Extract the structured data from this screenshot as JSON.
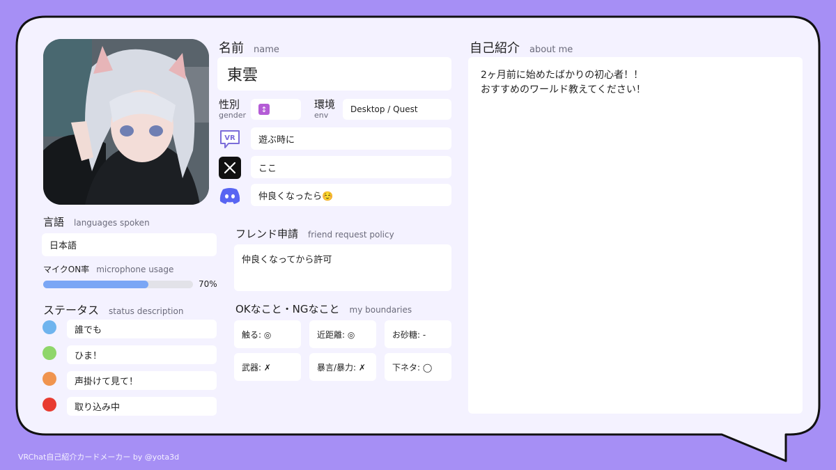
{
  "profile": {
    "name_label": "名前",
    "name_sub": "name",
    "name_value": "東雲",
    "gender_label": "性別",
    "gender_sub": "gender",
    "gender_value": "🚺",
    "env_label": "環境",
    "env_sub": "env",
    "env_value": "Desktop / Quest",
    "vr_value": "遊ぶ時に",
    "x_value": "ここ",
    "discord_value": "仲良くなったら☺️"
  },
  "languages": {
    "label": "言語",
    "sub": "languages spoken",
    "value": "日本語"
  },
  "mic": {
    "label": "マイクON率",
    "sub": "microphone usage",
    "percent": 70,
    "percent_text": "70%",
    "bar_color": "#7aa6f5"
  },
  "status": {
    "label": "ステータス",
    "sub": "status description",
    "items": [
      {
        "color": "#6fb4ee",
        "text": "誰でも"
      },
      {
        "color": "#8fd66a",
        "text": "ひま！"
      },
      {
        "color": "#f0944e",
        "text": "声掛けて見て！"
      },
      {
        "color": "#e83b30",
        "text": "取り込み中"
      }
    ]
  },
  "friend": {
    "label": "フレンド申請",
    "sub": "friend request policy",
    "value": "仲良くなってから許可"
  },
  "boundaries": {
    "label": "OKなこと・NGなこと",
    "sub": "my boundaries",
    "items": [
      "触る: ◎",
      "近距離: ◎",
      "お砂糖: -",
      "武器: ✗",
      "暴言/暴力: ✗",
      "下ネタ: ◯"
    ]
  },
  "about": {
    "label": "自己紹介",
    "sub": "about me",
    "lines": [
      "2ヶ月前に始めたばかりの初心者！！",
      "おすすめのワールド教えてください！"
    ]
  },
  "icons": {
    "vr": "vrchat-speech-icon",
    "x": "x-logo-icon",
    "discord": "discord-icon",
    "vr_text": "VR"
  },
  "colors": {
    "background": "#a68ff5",
    "card": "#f4f2ff",
    "border": "#111111"
  },
  "footer": "VRChat自己紹介カードメーカー by @yota3d"
}
